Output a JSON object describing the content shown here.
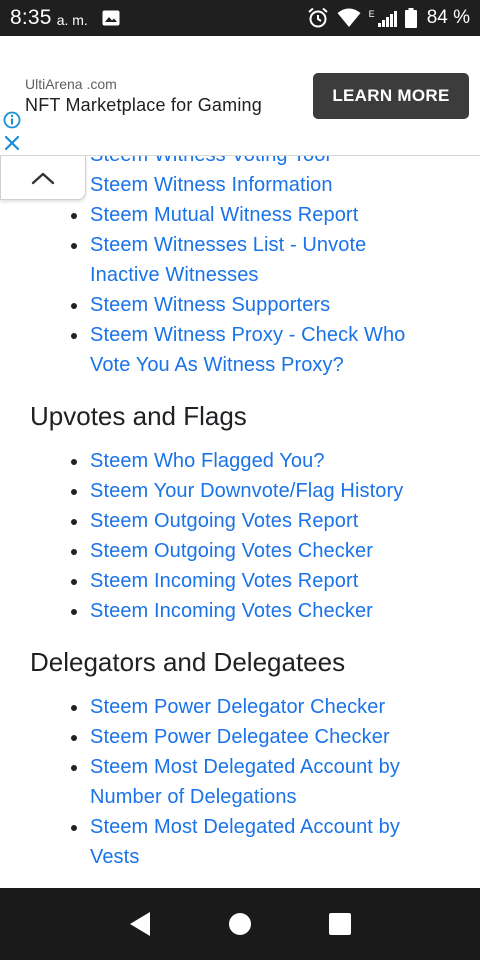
{
  "status_bar": {
    "time": "8:35",
    "ampm": "a. m.",
    "network_label": "E",
    "battery": "84 %"
  },
  "ad": {
    "domain": "UltiArena .com",
    "title": "NFT Marketplace for Gaming",
    "cta": "LEARN MORE"
  },
  "sections": [
    {
      "heading": "",
      "items": [
        "Steem Witness Voting Tool",
        "Steem Witness Information",
        "Steem Mutual Witness Report",
        "Steem Witnesses List - Unvote Inactive Witnesses",
        "Steem Witness Supporters",
        "Steem Witness Proxy - Check Who Vote You As Witness Proxy?"
      ]
    },
    {
      "heading": "Upvotes and Flags",
      "items": [
        "Steem Who Flagged You?",
        "Steem Your Downvote/Flag History",
        "Steem Outgoing Votes Report",
        "Steem Outgoing Votes Checker",
        "Steem Incoming Votes Report",
        "Steem Incoming Votes Checker"
      ]
    },
    {
      "heading": "Delegators and Delegatees",
      "items": [
        "Steem Power Delegator Checker",
        "Steem Power Delegatee Checker",
        "Steem Most Delegated Account by Number of Delegations",
        "Steem Most Delegated Account by Vests"
      ]
    }
  ],
  "colors": {
    "link": "#1a73e8",
    "status_bar": "#1f1f1f",
    "nav_bar": "#1a1a1a",
    "ad_button": "#3c3c3c"
  }
}
